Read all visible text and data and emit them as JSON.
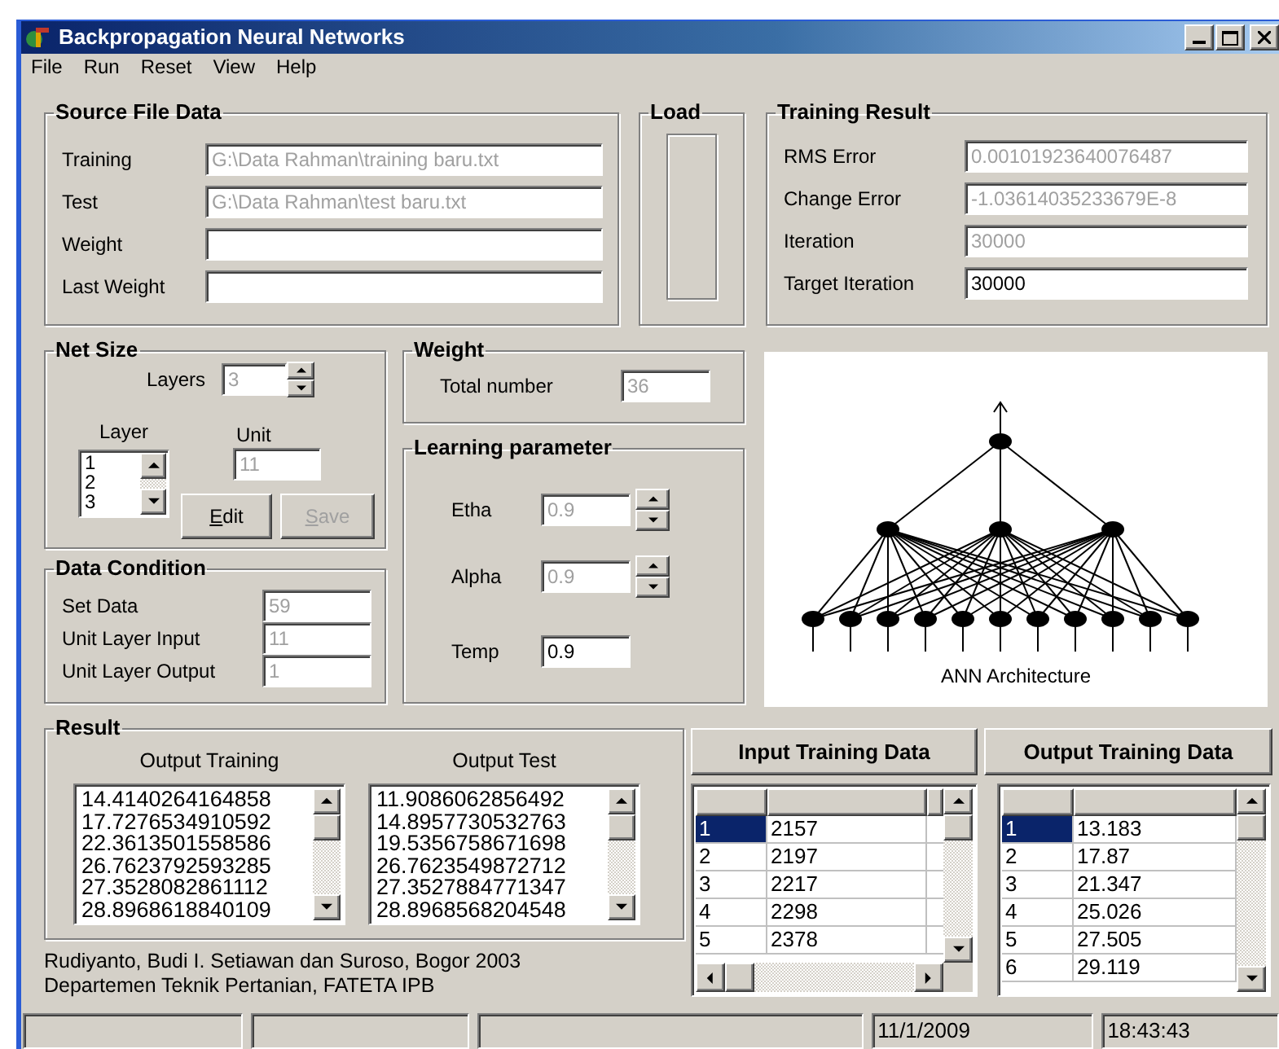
{
  "window": {
    "title": "Backpropagation Neural Networks"
  },
  "menu": [
    "File",
    "Run",
    "Reset",
    "View",
    "Help"
  ],
  "source_file_data": {
    "title": "Source File Data",
    "fields": [
      {
        "label": "Training",
        "value": "G:\\Data Rahman\\training baru.txt",
        "disabled": true
      },
      {
        "label": "Test",
        "value": "G:\\Data Rahman\\test baru.txt",
        "disabled": true
      },
      {
        "label": "Weight"
      },
      {
        "label": "Last Weight"
      }
    ]
  },
  "load": {
    "title": "Load"
  },
  "training_result": {
    "title": "Training Result",
    "fields": [
      {
        "label": "RMS Error",
        "value": "0.00101923640076487",
        "disabled": true
      },
      {
        "label": "Change Error",
        "value": "-1.03614035233679E-8",
        "disabled": true
      },
      {
        "label": "Iteration",
        "value": "30000",
        "disabled": true
      },
      {
        "label": "Target Iteration",
        "value": "30000",
        "disabled": false
      }
    ]
  },
  "net_size": {
    "title": "Net Size",
    "layers_label": "Layers",
    "layers_value": "3",
    "layer_label": "Layer",
    "layer_items": [
      "1",
      "2",
      "3"
    ],
    "unit_label": "Unit",
    "unit_value": "11",
    "buttons": [
      {
        "label": "Edit",
        "disabled": false
      },
      {
        "label": "Save",
        "disabled": true
      }
    ]
  },
  "data_condition": {
    "title": "Data Condition",
    "fields": [
      {
        "label": "Set Data",
        "value": "59",
        "disabled": true
      },
      {
        "label": "Unit Layer Input",
        "value": "11",
        "disabled": true
      },
      {
        "label": "Unit Layer Output",
        "value": "1",
        "disabled": true
      }
    ]
  },
  "weight": {
    "title": "Weight",
    "label": "Total number",
    "value": "36"
  },
  "learning_parameter": {
    "title": "Learning parameter",
    "fields": [
      {
        "label": "Etha",
        "value": "0.9",
        "disabled": true,
        "kind": "spin"
      },
      {
        "label": "Alpha",
        "value": "0.9",
        "disabled": true,
        "kind": "spin"
      },
      {
        "label": "Temp",
        "value": "0.9",
        "disabled": false,
        "kind": "text"
      }
    ]
  },
  "ann": {
    "caption": "ANN Architecture"
  },
  "result": {
    "title": "Result",
    "lists": [
      {
        "heading": "Output Training",
        "values": [
          "14.4140264164858",
          "17.7276534910592",
          "22.3613501558586",
          "26.7623792593285",
          "27.3528082861112",
          "28.8968618840109"
        ]
      },
      {
        "heading": "Output Test",
        "values": [
          "11.9086062856492",
          "14.8957730532763",
          "19.5356758671698",
          "26.7623549872712",
          "27.3527884771347",
          "28.8968568204548"
        ]
      }
    ]
  },
  "credits": [
    "Rudiyanto, Budi I. Setiawan dan Suroso, Bogor 2003",
    "Departemen Teknik Pertanian, FATETA IPB"
  ],
  "input_training_data": {
    "button": "Input Training Data",
    "rows": [
      {
        "number": "1",
        "value": "2157",
        "selected": true
      },
      {
        "number": "2",
        "value": "2197",
        "selected": false
      },
      {
        "number": "3",
        "value": "2217",
        "selected": false
      },
      {
        "number": "4",
        "value": "2298",
        "selected": false
      },
      {
        "number": "5",
        "value": "2378",
        "selected": false
      }
    ]
  },
  "output_training_data": {
    "button": "Output Training Data",
    "rows": [
      {
        "number": "1",
        "value": "13.183",
        "selected": true
      },
      {
        "number": "2",
        "value": "17.87",
        "selected": false
      },
      {
        "number": "3",
        "value": "21.347",
        "selected": false
      },
      {
        "number": "4",
        "value": "25.026",
        "selected": false
      },
      {
        "number": "5",
        "value": "27.505",
        "selected": false
      },
      {
        "number": "6",
        "value": "29.119",
        "selected": false
      }
    ]
  },
  "status_bar": {
    "date": "11/1/2009",
    "time": "18:43:43"
  }
}
